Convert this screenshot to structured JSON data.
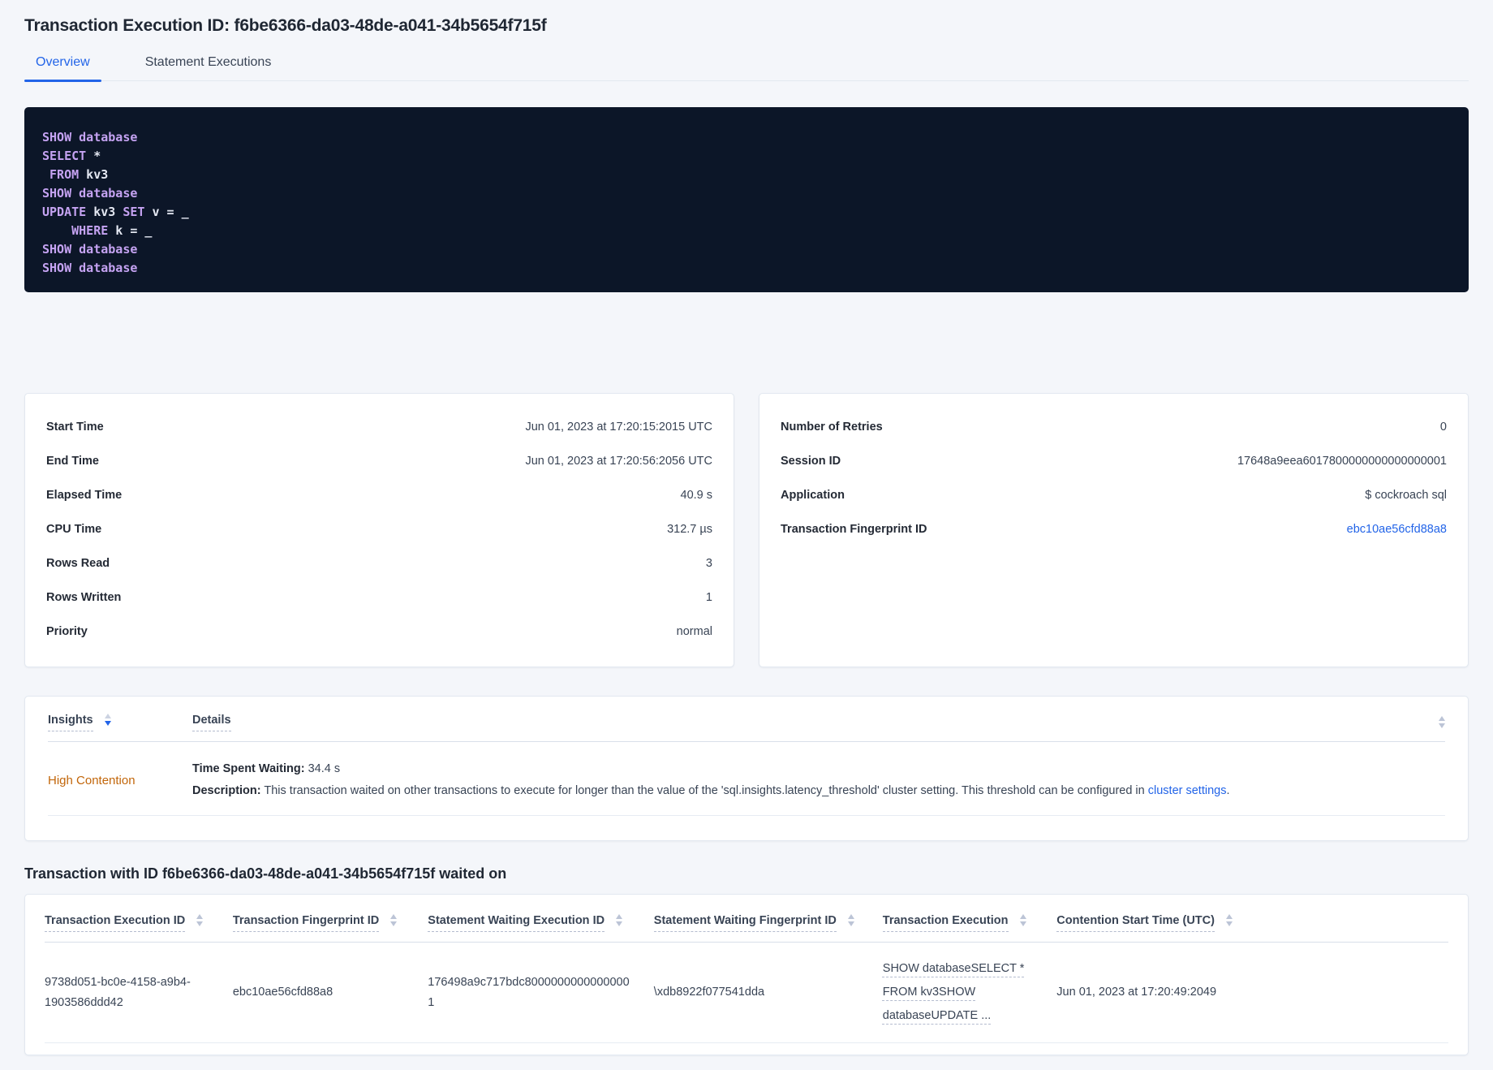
{
  "page": {
    "title": "Transaction Execution ID: f6be6366-da03-48de-a041-34b5654f715f"
  },
  "tabs": [
    {
      "label": "Overview",
      "active": true
    },
    {
      "label": "Statement Executions",
      "active": false
    }
  ],
  "sql_box": {
    "lines": [
      [
        {
          "t": "SHOW database",
          "k": 1
        }
      ],
      [
        {
          "t": "SELECT",
          "k": 1
        },
        {
          "t": " *",
          "k": 0
        }
      ],
      [
        {
          "t": " FROM",
          "k": 1
        },
        {
          "t": " kv3",
          "k": 0
        }
      ],
      [
        {
          "t": "SHOW database",
          "k": 1
        }
      ],
      [
        {
          "t": "UPDATE",
          "k": 1
        },
        {
          "t": " kv3 ",
          "k": 0
        },
        {
          "t": "SET",
          "k": 1
        },
        {
          "t": " v = _",
          "k": 0
        }
      ],
      [
        {
          "t": "    WHERE",
          "k": 1
        },
        {
          "t": " k = _",
          "k": 0
        }
      ],
      [
        {
          "t": "SHOW database",
          "k": 1
        }
      ],
      [
        {
          "t": "SHOW database",
          "k": 1
        }
      ]
    ]
  },
  "summary_left": {
    "rows": [
      {
        "label": "Start Time",
        "value": "Jun 01, 2023 at 17:20:15:2015 UTC"
      },
      {
        "label": "End Time",
        "value": "Jun 01, 2023 at 17:20:56:2056 UTC"
      },
      {
        "label": "Elapsed Time",
        "value": "40.9 s"
      },
      {
        "label": "CPU Time",
        "value": "312.7 µs"
      },
      {
        "label": "Rows Read",
        "value": "3"
      },
      {
        "label": "Rows Written",
        "value": "1"
      },
      {
        "label": "Priority",
        "value": "normal"
      }
    ]
  },
  "summary_right": {
    "rows": [
      {
        "label": "Number of Retries",
        "value": "0"
      },
      {
        "label": "Session ID",
        "value": "17648a9eea6017800000000000000001"
      },
      {
        "label": "Application",
        "value": "$ cockroach sql"
      },
      {
        "label": "Transaction Fingerprint ID",
        "value": "ebc10ae56cfd88a8",
        "link": true
      }
    ]
  },
  "insights_table": {
    "headers": {
      "insights": "Insights",
      "details": "Details"
    },
    "row": {
      "insight": "High Contention",
      "waiting_label": "Time Spent Waiting:",
      "waiting_value": "34.4 s",
      "desc_label": "Description:",
      "desc_text": "This transaction waited on other transactions to execute for longer than the value of the 'sql.insights.latency_threshold' cluster setting. This threshold can be configured in ",
      "desc_link": "cluster settings",
      "desc_suffix": "."
    }
  },
  "waited_section": {
    "heading": "Transaction with ID f6be6366-da03-48de-a041-34b5654f715f waited on",
    "columns": [
      "Transaction Execution ID",
      "Transaction Fingerprint ID",
      "Statement Waiting Execution ID",
      "Statement Waiting Fingerprint ID",
      "Transaction Execution",
      "Contention Start Time (UTC)"
    ],
    "row": {
      "transaction_execution_id": "9738d051-bc0e-4158-a9b4-1903586ddd42",
      "transaction_fingerprint_id": "ebc10ae56cfd88a8",
      "statement_waiting_execution_id": "176498a9c717bdc80000000000000001",
      "statement_waiting_fingerprint_id": "\\xdb8922f077541dda",
      "transaction_execution": "SHOW databaseSELECT * FROM kv3SHOW databaseUPDATE ...",
      "contention_start_time": "Jun 01, 2023 at 17:20:49:2049"
    }
  },
  "colors": {
    "accent_blue": "#2264e8",
    "code_background": "#0c1628",
    "code_keyword": "#c5a3f2",
    "code_plain": "#e4e8f2",
    "insight_warning": "#c2660a",
    "page_background": "#f4f6fa"
  }
}
